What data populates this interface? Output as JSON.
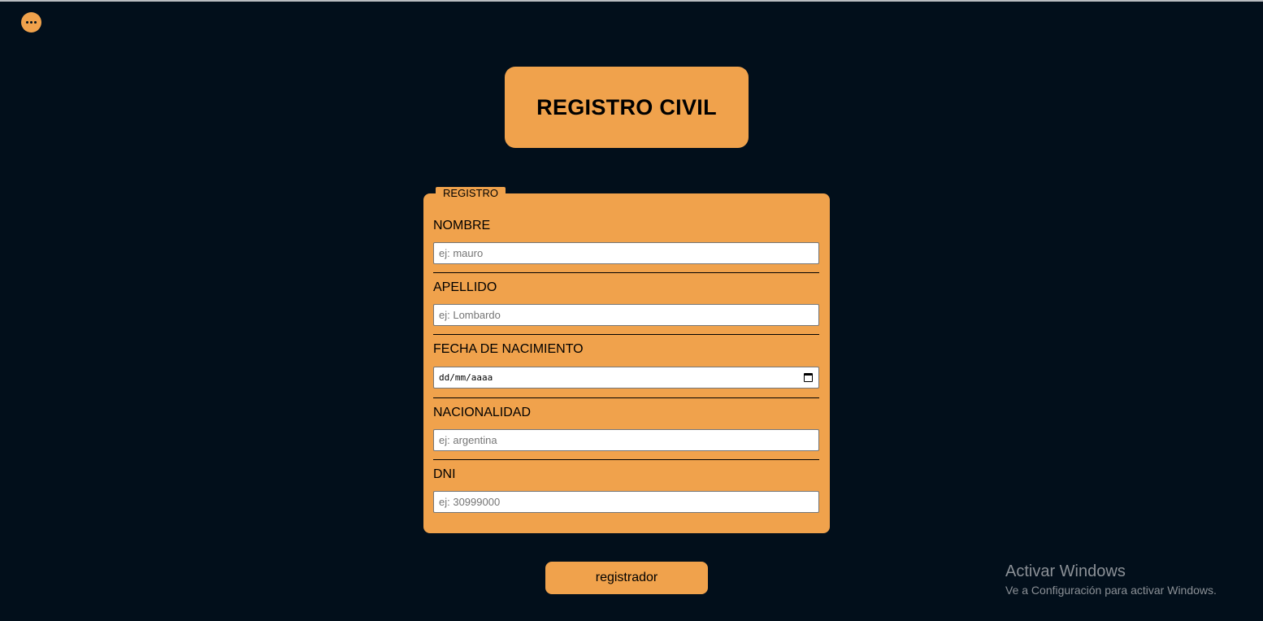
{
  "app": {
    "title": "REGISTRO CIVIL",
    "accent_color": "#f0a24c",
    "background_color": "#020f1b",
    "menu_icon": "ellipsis-icon"
  },
  "form": {
    "legend": "REGISTRO",
    "fields": [
      {
        "label": "NOMBRE",
        "placeholder": "ej: mauro"
      },
      {
        "label": "APELLIDO",
        "placeholder": "ej: Lombardo"
      },
      {
        "label": "FECHA DE NACIMIENTO",
        "placeholder": "dd/mm/aaaa",
        "icon": "calendar-icon"
      },
      {
        "label": "NACIONALIDAD",
        "placeholder": "ej: argentina"
      },
      {
        "label": "DNI",
        "placeholder": "ej: 30999000"
      }
    ],
    "submit_label": "registrador"
  },
  "watermark": {
    "title": "Activar Windows",
    "subtitle": "Ve a Configuración para activar Windows."
  }
}
